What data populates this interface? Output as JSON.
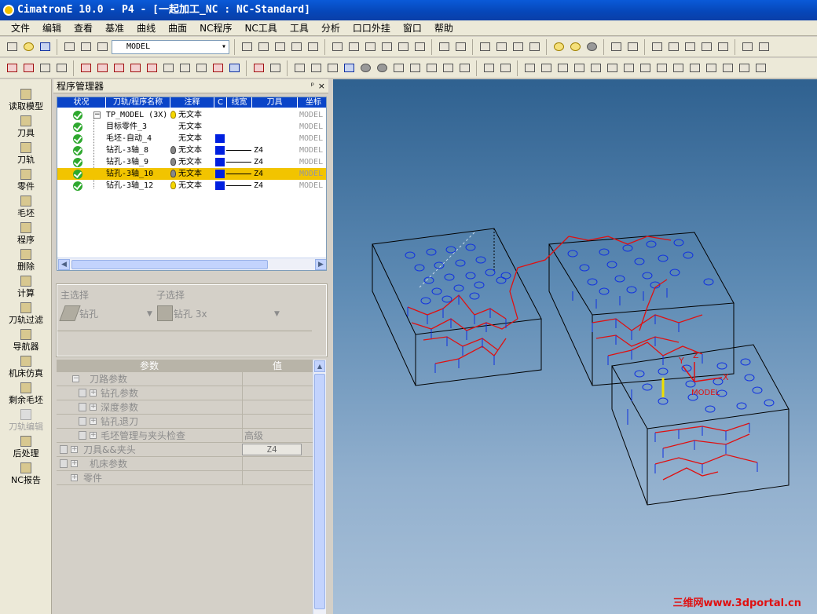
{
  "window": {
    "title": "CimatronE 10.0 - P4 - [一起加工_NC : NC-Standard]"
  },
  "menu": [
    "文件",
    "编辑",
    "查看",
    "基准",
    "曲线",
    "曲面",
    "NC程序",
    "NC工具",
    "工具",
    "分析",
    "口口外挂",
    "窗口",
    "帮助"
  ],
  "toolbar": {
    "model_combo": "MODEL"
  },
  "left_toolbar": [
    {
      "label": "读取模型",
      "enabled": true
    },
    {
      "label": "刀具",
      "enabled": true
    },
    {
      "label": "刀轨",
      "enabled": true
    },
    {
      "label": "零件",
      "enabled": true
    },
    {
      "label": "毛坯",
      "enabled": true
    },
    {
      "label": "程序",
      "enabled": true
    },
    {
      "label": "删除",
      "enabled": true
    },
    {
      "label": "计算",
      "enabled": true
    },
    {
      "label": "刀轨过滤",
      "enabled": true
    },
    {
      "label": "导航器",
      "enabled": true
    },
    {
      "label": "机床仿真",
      "enabled": true
    },
    {
      "label": "剩余毛坯",
      "enabled": true
    },
    {
      "label": "刀轨编辑",
      "enabled": false
    },
    {
      "label": "后处理",
      "enabled": true
    },
    {
      "label": "NC报告",
      "enabled": true
    }
  ],
  "program_manager": {
    "title": "程序管理器",
    "pin": "ᵖ",
    "close": "×",
    "columns": [
      "状况",
      "刀轨/程序名称",
      "注释",
      "C",
      "线宽",
      "刀具",
      "坐标"
    ],
    "rows": [
      {
        "status": "ok",
        "name": "TP_MODEL (3X)",
        "bulb": "yellow",
        "note": "无文本",
        "color": false,
        "tool": "",
        "coord": "MODEL",
        "selected": false
      },
      {
        "status": "ok",
        "name": "目标零件_3",
        "bulb": "",
        "note": "无文本",
        "color": false,
        "tool": "",
        "coord": "MODEL",
        "selected": false
      },
      {
        "status": "ok",
        "name": "毛坯-自动_4",
        "bulb": "",
        "note": "无文本",
        "color": true,
        "tool": "",
        "coord": "MODEL",
        "selected": false
      },
      {
        "status": "ok",
        "name": "钻孔-3轴_8",
        "bulb": "gray",
        "note": "无文本",
        "color": true,
        "tool": "Z4",
        "coord": "MODEL",
        "selected": false
      },
      {
        "status": "ok",
        "name": "钻孔-3轴_9",
        "bulb": "gray",
        "note": "无文本",
        "color": true,
        "tool": "Z4",
        "coord": "MODEL",
        "selected": false
      },
      {
        "status": "ok",
        "name": "钻孔-3轴_10",
        "bulb": "gray",
        "note": "无文本",
        "color": true,
        "tool": "Z4",
        "coord": "MODEL",
        "selected": true
      },
      {
        "status": "ok",
        "name": "钻孔-3轴_12",
        "bulb": "yellow",
        "note": "无文本",
        "color": true,
        "tool": "Z4",
        "coord": "MODEL",
        "selected": false
      }
    ]
  },
  "selection": {
    "main_label": "主选择",
    "main_value": "钻孔",
    "sub_label": "子选择",
    "sub_value": "钻孔 3x"
  },
  "params": {
    "col_param": "参数",
    "col_value": "值",
    "rows": [
      {
        "label": "刀路参数",
        "indent": 0,
        "value": ""
      },
      {
        "label": "钻孔参数",
        "indent": 1,
        "value": ""
      },
      {
        "label": "深度参数",
        "indent": 1,
        "value": ""
      },
      {
        "label": "钻孔退刀",
        "indent": 1,
        "value": ""
      },
      {
        "label": "毛坯管理与夹头检查",
        "indent": 1,
        "value": "高级"
      },
      {
        "label": "刀具&&夹头",
        "indent": 0,
        "value": "Z4",
        "button": true
      },
      {
        "label": "机床参数",
        "indent": 0,
        "value": ""
      },
      {
        "label": "零件",
        "indent": 0,
        "value": ""
      }
    ]
  },
  "viewport": {
    "axis_labels": {
      "x": "X",
      "y": "Y",
      "z": "Z",
      "model": "MODEL"
    },
    "watermark": "三维网www.3dportal.cn"
  },
  "colors": {
    "title_blue": "#0a5ad8",
    "selection_yellow": "#f2c400",
    "toolpath_red": "#e01010",
    "hole_blue": "#1030e0"
  }
}
